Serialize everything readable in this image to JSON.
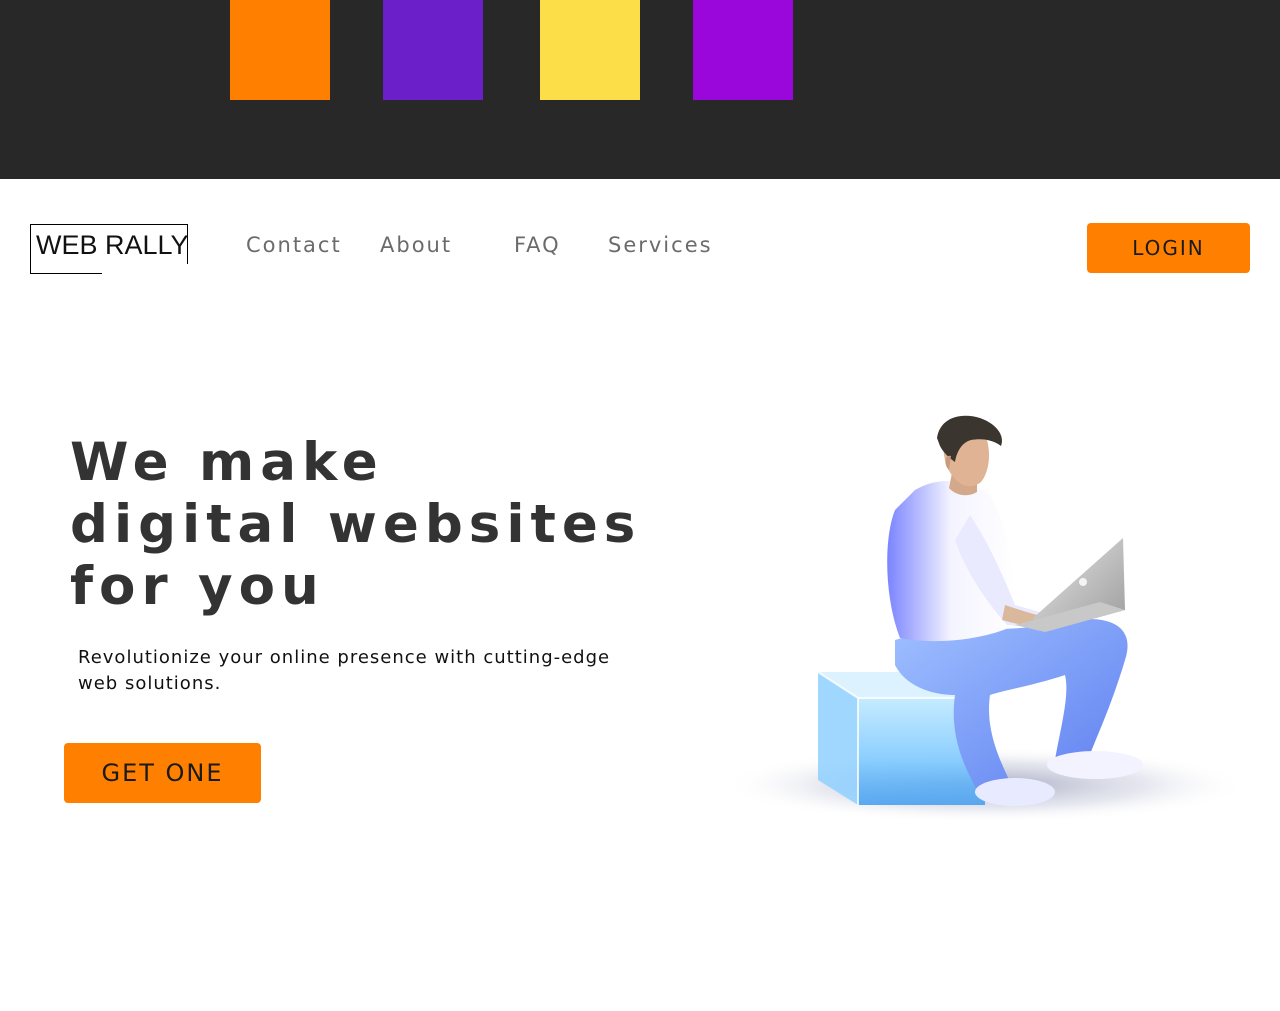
{
  "top_swatches": [
    {
      "color": "#ff8000"
    },
    {
      "color": "#6b1fc9"
    },
    {
      "color": "#fcde48"
    },
    {
      "color": "#9a07da"
    }
  ],
  "brand": {
    "logo_text": "WEB RALLY"
  },
  "nav": {
    "items": [
      {
        "label": "Contact"
      },
      {
        "label": "About"
      },
      {
        "label": "FAQ"
      },
      {
        "label": "Services"
      }
    ],
    "login_label": "LOGIN"
  },
  "hero": {
    "title_lines": [
      "We make",
      "digital websites",
      "for you"
    ],
    "subtitle": "Revolutionize your online presence with cutting-edge web solutions.",
    "cta_label": "GET ONE"
  },
  "colors": {
    "accent": "#ff8000",
    "top_bar": "#282828",
    "title": "#333333"
  }
}
